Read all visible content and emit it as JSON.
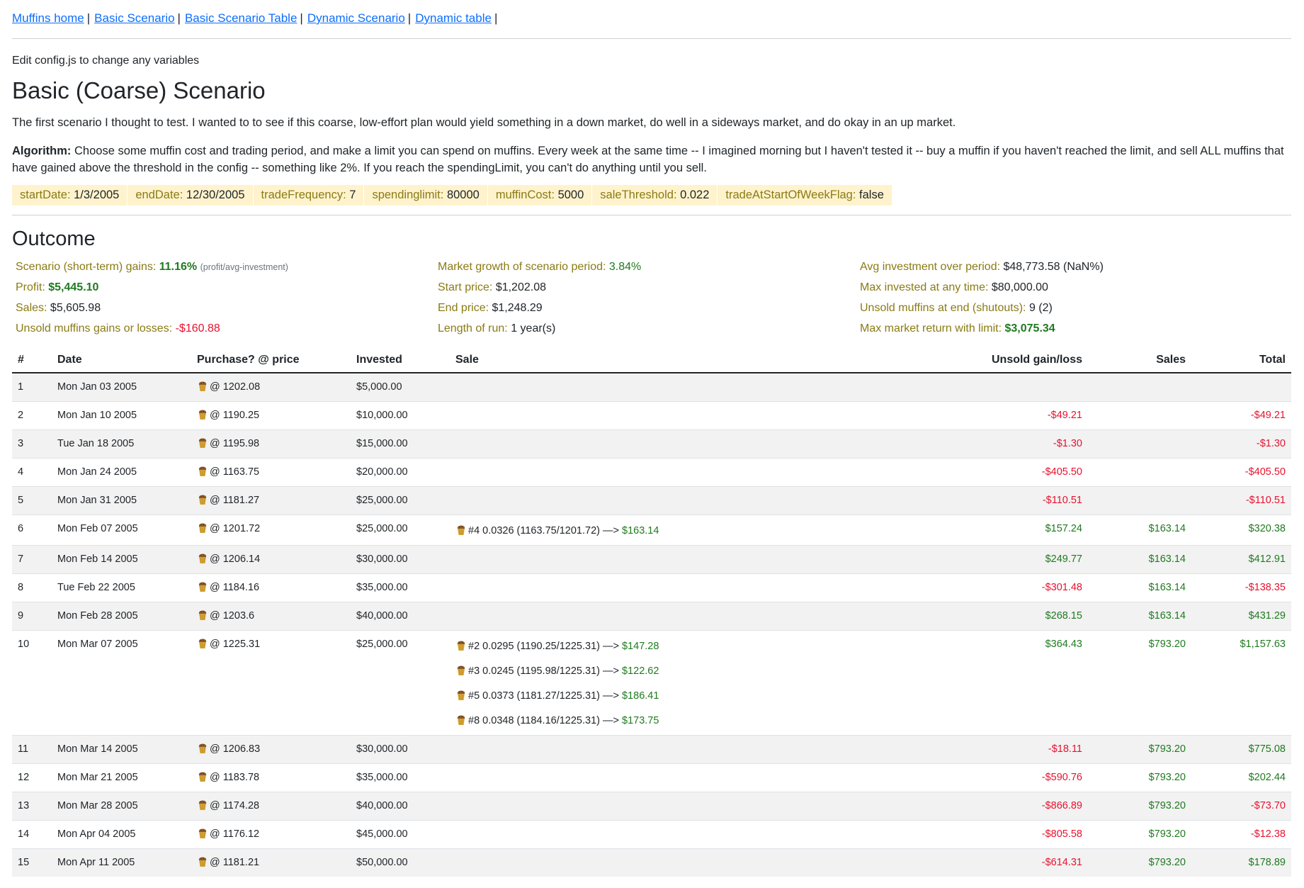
{
  "nav": {
    "links": [
      "Muffins home",
      "Basic Scenario",
      "Basic Scenario Table",
      "Dynamic Scenario",
      "Dynamic table"
    ],
    "separator": "|"
  },
  "note": "Edit config.js to change any variables",
  "title": "Basic (Coarse) Scenario",
  "intro": "The first scenario I thought to test. I wanted to to see if this coarse, low-effort plan would yield something in a down market, do well in a sideways market, and do okay in an up market.",
  "algorithm": {
    "label": "Algorithm:",
    "text": "Choose some muffin cost and trading period, and make a limit you can spend on muffins. Every week at the same time -- I imagined morning but I haven't tested it -- buy a muffin if you haven't reached the limit, and sell ALL muffins that have gained above the threshold in the config -- something like 2%. If you reach the spendingLimit, you can't do anything until you sell."
  },
  "config": [
    {
      "key": "startDate:",
      "value": "1/3/2005"
    },
    {
      "key": "endDate:",
      "value": "12/30/2005"
    },
    {
      "key": "tradeFrequency:",
      "value": "7"
    },
    {
      "key": "spendinglimit:",
      "value": "80000"
    },
    {
      "key": "muffinCost:",
      "value": "5000"
    },
    {
      "key": "saleThreshold:",
      "value": "0.022"
    },
    {
      "key": "tradeAtStartOfWeekFlag:",
      "value": "false"
    }
  ],
  "outcome": {
    "heading": "Outcome",
    "gains_label": "Scenario (short-term) gains:",
    "gains_value": "11.16%",
    "gains_note": "(profit/avg-investment)",
    "profit_label": "Profit:",
    "profit_value": "$5,445.10",
    "sales_label": "Sales:",
    "sales_value": "$5,605.98",
    "unsold_label": "Unsold muffins gains or losses:",
    "unsold_value": "-$160.88",
    "market_growth_label": "Market growth of scenario period:",
    "market_growth_value": "3.84%",
    "start_price_label": "Start price:",
    "start_price_value": "$1,202.08",
    "end_price_label": "End price:",
    "end_price_value": "$1,248.29",
    "length_label": "Length of run:",
    "length_value": "1 year(s)",
    "avg_inv_label": "Avg investment over period:",
    "avg_inv_value": "$48,773.58 (NaN%)",
    "max_inv_label": "Max invested at any time:",
    "max_inv_value": "$80,000.00",
    "unsold_end_label": "Unsold muffins at end (shutouts):",
    "unsold_end_value": "9 (2)",
    "max_return_label": "Max market return with limit:",
    "max_return_value": "$3,075.34"
  },
  "table": {
    "headers": [
      "#",
      "Date",
      "Purchase? @ price",
      "Invested",
      "Sale",
      "Unsold gain/loss",
      "Sales",
      "Total"
    ],
    "rows": [
      {
        "n": "1",
        "date": "Mon Jan 03 2005",
        "purchase": "@ 1202.08",
        "invested": "$5,000.00",
        "sales_list": [],
        "unsold": "",
        "unsold_sign": "",
        "sales": "",
        "total": "",
        "total_sign": ""
      },
      {
        "n": "2",
        "date": "Mon Jan 10 2005",
        "purchase": "@ 1190.25",
        "invested": "$10,000.00",
        "sales_list": [],
        "unsold": "-$49.21",
        "unsold_sign": "neg",
        "sales": "",
        "total": "-$49.21",
        "total_sign": "neg"
      },
      {
        "n": "3",
        "date": "Tue Jan 18 2005",
        "purchase": "@ 1195.98",
        "invested": "$15,000.00",
        "sales_list": [],
        "unsold": "-$1.30",
        "unsold_sign": "neg",
        "sales": "",
        "total": "-$1.30",
        "total_sign": "neg"
      },
      {
        "n": "4",
        "date": "Mon Jan 24 2005",
        "purchase": "@ 1163.75",
        "invested": "$20,000.00",
        "sales_list": [],
        "unsold": "-$405.50",
        "unsold_sign": "neg",
        "sales": "",
        "total": "-$405.50",
        "total_sign": "neg"
      },
      {
        "n": "5",
        "date": "Mon Jan 31 2005",
        "purchase": "@ 1181.27",
        "invested": "$25,000.00",
        "sales_list": [],
        "unsold": "-$110.51",
        "unsold_sign": "neg",
        "sales": "",
        "total": "-$110.51",
        "total_sign": "neg"
      },
      {
        "n": "6",
        "date": "Mon Feb 07 2005",
        "purchase": "@ 1201.72",
        "invested": "$25,000.00",
        "sales_list": [
          {
            "text": "#4 0.0326 (1163.75/1201.72) —>",
            "amount": "$163.14"
          }
        ],
        "unsold": "$157.24",
        "unsold_sign": "pos",
        "sales": "$163.14",
        "total": "$320.38",
        "total_sign": "pos"
      },
      {
        "n": "7",
        "date": "Mon Feb 14 2005",
        "purchase": "@ 1206.14",
        "invested": "$30,000.00",
        "sales_list": [],
        "unsold": "$249.77",
        "unsold_sign": "pos",
        "sales": "$163.14",
        "total": "$412.91",
        "total_sign": "pos"
      },
      {
        "n": "8",
        "date": "Tue Feb 22 2005",
        "purchase": "@ 1184.16",
        "invested": "$35,000.00",
        "sales_list": [],
        "unsold": "-$301.48",
        "unsold_sign": "neg",
        "sales": "$163.14",
        "total": "-$138.35",
        "total_sign": "neg"
      },
      {
        "n": "9",
        "date": "Mon Feb 28 2005",
        "purchase": "@ 1203.6",
        "invested": "$40,000.00",
        "sales_list": [],
        "unsold": "$268.15",
        "unsold_sign": "pos",
        "sales": "$163.14",
        "total": "$431.29",
        "total_sign": "pos"
      },
      {
        "n": "10",
        "date": "Mon Mar 07 2005",
        "purchase": "@ 1225.31",
        "invested": "$25,000.00",
        "sales_list": [
          {
            "text": "#2 0.0295 (1190.25/1225.31) —>",
            "amount": "$147.28"
          },
          {
            "text": "#3 0.0245 (1195.98/1225.31) —>",
            "amount": "$122.62"
          },
          {
            "text": "#5 0.0373 (1181.27/1225.31) —>",
            "amount": "$186.41"
          },
          {
            "text": "#8 0.0348 (1184.16/1225.31) —>",
            "amount": "$173.75"
          }
        ],
        "unsold": "$364.43",
        "unsold_sign": "pos",
        "sales": "$793.20",
        "total": "$1,157.63",
        "total_sign": "pos"
      },
      {
        "n": "11",
        "date": "Mon Mar 14 2005",
        "purchase": "@ 1206.83",
        "invested": "$30,000.00",
        "sales_list": [],
        "unsold": "-$18.11",
        "unsold_sign": "neg",
        "sales": "$793.20",
        "total": "$775.08",
        "total_sign": "pos"
      },
      {
        "n": "12",
        "date": "Mon Mar 21 2005",
        "purchase": "@ 1183.78",
        "invested": "$35,000.00",
        "sales_list": [],
        "unsold": "-$590.76",
        "unsold_sign": "neg",
        "sales": "$793.20",
        "total": "$202.44",
        "total_sign": "pos"
      },
      {
        "n": "13",
        "date": "Mon Mar 28 2005",
        "purchase": "@ 1174.28",
        "invested": "$40,000.00",
        "sales_list": [],
        "unsold": "-$866.89",
        "unsold_sign": "neg",
        "sales": "$793.20",
        "total": "-$73.70",
        "total_sign": "neg"
      },
      {
        "n": "14",
        "date": "Mon Apr 04 2005",
        "purchase": "@ 1176.12",
        "invested": "$45,000.00",
        "sales_list": [],
        "unsold": "-$805.58",
        "unsold_sign": "neg",
        "sales": "$793.20",
        "total": "-$12.38",
        "total_sign": "neg"
      },
      {
        "n": "15",
        "date": "Mon Apr 11 2005",
        "purchase": "@ 1181.21",
        "invested": "$50,000.00",
        "sales_list": [],
        "unsold": "-$614.31",
        "unsold_sign": "neg",
        "sales": "$793.20",
        "total": "$178.89",
        "total_sign": "pos"
      }
    ]
  },
  "colors": {
    "link": "#0d6efd",
    "label": "#8a7b14",
    "positive": "#1f7a1f",
    "negative": "#e8122e",
    "config_bg": "#fff3cd"
  },
  "icons": {
    "muffin": "muffin-icon"
  }
}
